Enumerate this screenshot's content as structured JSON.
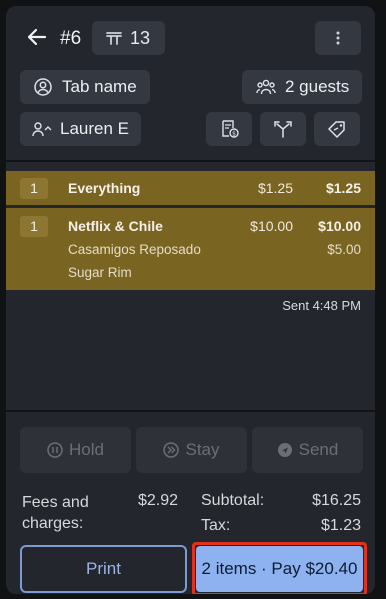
{
  "header": {
    "order_number": "#6",
    "table_number": "13",
    "tab_name_label": "Tab name",
    "guests_label": "2 guests",
    "server_name": "Lauren E"
  },
  "items": [
    {
      "qty": "1",
      "name": "Everything",
      "price": "$1.25",
      "total": "$1.25",
      "modifiers": []
    },
    {
      "qty": "1",
      "name": "Netflix & Chile",
      "price": "$10.00",
      "total": "$10.00",
      "modifiers": [
        {
          "name": "Casamigos Reposado",
          "price": "$5.00"
        },
        {
          "name": "Sugar Rim",
          "price": ""
        }
      ]
    }
  ],
  "sent_status": "Sent 4:48 PM",
  "actions": {
    "hold": "Hold",
    "stay": "Stay",
    "send": "Send"
  },
  "totals": {
    "fees_label": "Fees and charges:",
    "fees_value": "$2.92",
    "subtotal_label": "Subtotal:",
    "subtotal_value": "$16.25",
    "tax_label": "Tax:",
    "tax_value": "$1.23"
  },
  "buttons": {
    "print": "Print",
    "pay": "2 items · Pay $20.40"
  },
  "colors": {
    "item_highlight": "#7a6422",
    "pay_button": "#8eb1ef",
    "print_outline": "#7a9bd4",
    "annotation_outline": "#e2321c"
  }
}
